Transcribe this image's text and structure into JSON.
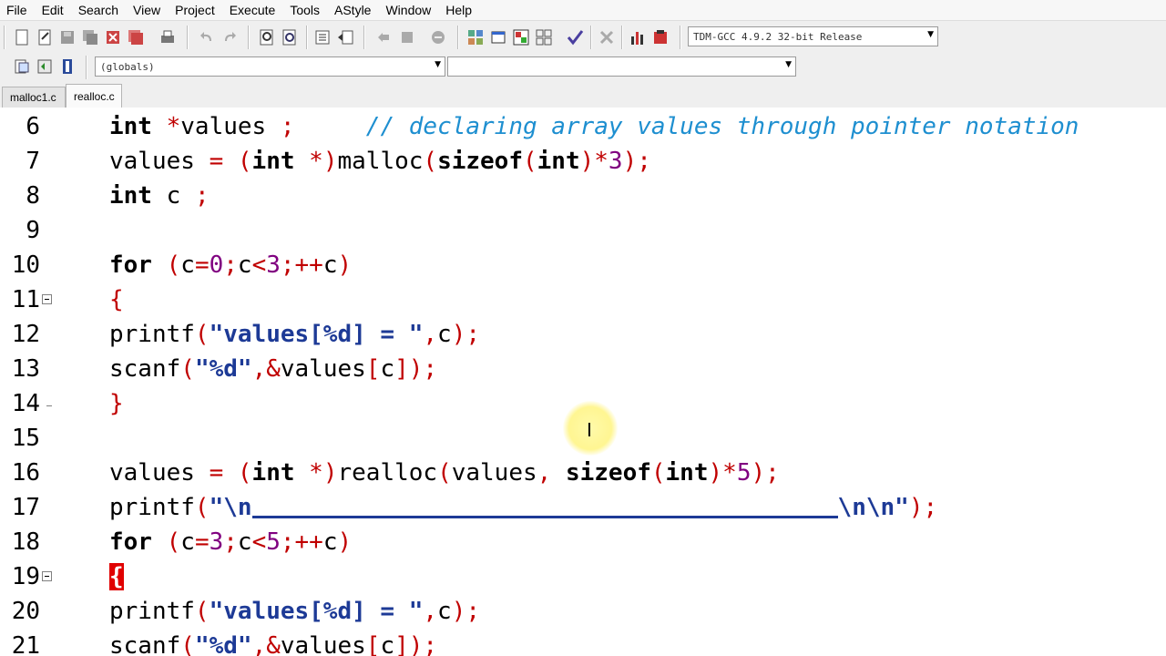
{
  "menu": [
    "File",
    "Edit",
    "Search",
    "View",
    "Project",
    "Execute",
    "Tools",
    "AStyle",
    "Window",
    "Help"
  ],
  "toolbar": {
    "compiler_select": "TDM-GCC 4.9.2 32-bit Release",
    "globals_select": "(globals)",
    "members_select": ""
  },
  "tabs": [
    {
      "label": "malloc1.c",
      "active": false
    },
    {
      "label": "realloc.c",
      "active": true
    }
  ],
  "editor": {
    "line_numbers": [
      "6",
      "7",
      "8",
      "9",
      "10",
      "11",
      "12",
      "13",
      "14",
      "15",
      "16",
      "17",
      "18",
      "19",
      "20",
      "21"
    ],
    "fold_lines": [
      "11",
      "19"
    ],
    "comment_line6": "// declaring array values through pointer notation"
  },
  "icons": [
    "new-file-icon",
    "open-icon",
    "save-icon",
    "save-all-icon",
    "close-icon",
    "close-all-icon",
    "print-icon",
    "undo-icon",
    "redo-icon",
    "find-icon",
    "replace-icon",
    "indent-icon",
    "unindent-icon",
    "bookmark-icon",
    "goto-icon",
    "compile-icon",
    "run-icon",
    "compile-run-icon",
    "rebuild-icon",
    "syntax-check-icon",
    "delete-icon",
    "chart-icon",
    "debug-icon"
  ]
}
